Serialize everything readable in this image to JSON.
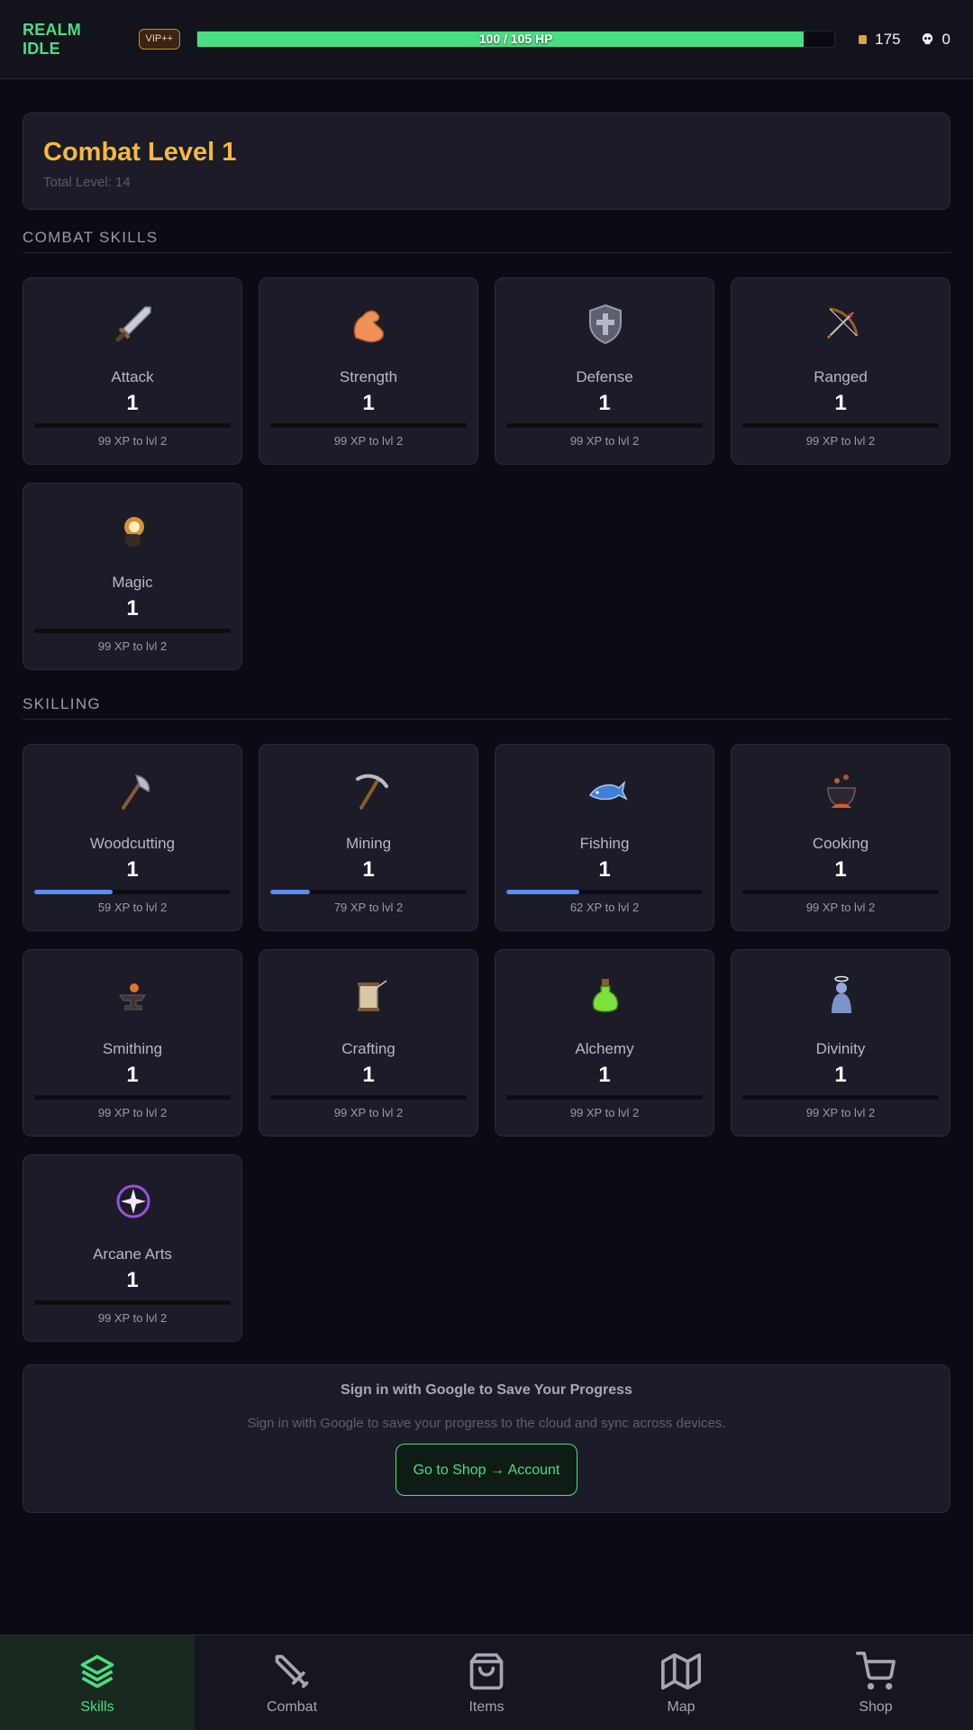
{
  "header": {
    "brand": "REALM IDLE",
    "vip_badge": "VIP++",
    "hp_text": "100 / 105 HP",
    "hp_fraction": 0.952,
    "coins": "175",
    "kills": "0"
  },
  "title_card": {
    "combat_level": "Combat Level 1",
    "total_level": "Total Level: 14"
  },
  "sections": {
    "combat": "COMBAT SKILLS",
    "skilling": "SKILLING"
  },
  "combat_skills": [
    {
      "name": "Attack",
      "level": "1",
      "xp_text": "99 XP to lvl 2",
      "progress": 0.0,
      "icon": "sword-icon"
    },
    {
      "name": "Strength",
      "level": "1",
      "xp_text": "99 XP to lvl 2",
      "progress": 0.0,
      "icon": "flexed-arm-icon"
    },
    {
      "name": "Defense",
      "level": "1",
      "xp_text": "99 XP to lvl 2",
      "progress": 0.0,
      "icon": "shield-icon"
    },
    {
      "name": "Ranged",
      "level": "1",
      "xp_text": "99 XP to lvl 2",
      "progress": 0.0,
      "icon": "bow-icon"
    },
    {
      "name": "Magic",
      "level": "1",
      "xp_text": "99 XP to lvl 2",
      "progress": 0.0,
      "icon": "magic-hand-icon"
    }
  ],
  "skilling_skills": [
    {
      "name": "Woodcutting",
      "level": "1",
      "xp_text": "59 XP to lvl 2",
      "progress": 0.4,
      "icon": "axe-icon"
    },
    {
      "name": "Mining",
      "level": "1",
      "xp_text": "79 XP to lvl 2",
      "progress": 0.2,
      "icon": "pickaxe-icon"
    },
    {
      "name": "Fishing",
      "level": "1",
      "xp_text": "62 XP to lvl 2",
      "progress": 0.37,
      "icon": "fish-icon"
    },
    {
      "name": "Cooking",
      "level": "1",
      "xp_text": "99 XP to lvl 2",
      "progress": 0.0,
      "icon": "cauldron-icon"
    },
    {
      "name": "Smithing",
      "level": "1",
      "xp_text": "99 XP to lvl 2",
      "progress": 0.0,
      "icon": "anvil-icon"
    },
    {
      "name": "Crafting",
      "level": "1",
      "xp_text": "99 XP to lvl 2",
      "progress": 0.0,
      "icon": "thread-spool-icon"
    },
    {
      "name": "Alchemy",
      "level": "1",
      "xp_text": "99 XP to lvl 2",
      "progress": 0.0,
      "icon": "potion-icon"
    },
    {
      "name": "Divinity",
      "level": "1",
      "xp_text": "99 XP to lvl 2",
      "progress": 0.0,
      "icon": "praying-angel-icon"
    },
    {
      "name": "Arcane Arts",
      "level": "1",
      "xp_text": "99 XP to lvl 2",
      "progress": 0.0,
      "icon": "arcane-star-icon"
    }
  ],
  "signin": {
    "title": "Sign in with Google to Save Your Progress",
    "description": "Sign in with Google to save your progress to the cloud and sync across devices.",
    "button": "Go to Shop → Account"
  },
  "nav": {
    "items": [
      {
        "label": "Skills",
        "icon": "layers-icon",
        "active": true
      },
      {
        "label": "Combat",
        "icon": "sword-icon",
        "active": false
      },
      {
        "label": "Items",
        "icon": "bag-icon",
        "active": false
      },
      {
        "label": "Map",
        "icon": "map-icon",
        "active": false
      },
      {
        "label": "Shop",
        "icon": "cart-icon",
        "active": false
      }
    ]
  },
  "colors": {
    "accent": "#4ade80",
    "gold": "#f5b93c",
    "xp_bar": "#5b8def",
    "background": "#0b0b14",
    "card": "#1c1c28"
  }
}
